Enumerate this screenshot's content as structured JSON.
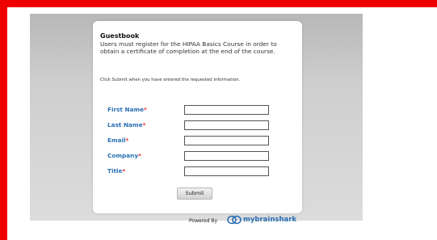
{
  "guestbook": {
    "title": "Guestbook",
    "description": "Users must register for the HIPAA Basics Course in order to obtain a certificate of completion at the end of the course.",
    "instructions": "Click Submit when you have entered the requested information."
  },
  "form": {
    "required_marker": "*",
    "fields": [
      {
        "label": "First Name",
        "value": ""
      },
      {
        "label": "Last Name",
        "value": ""
      },
      {
        "label": "Email",
        "value": ""
      },
      {
        "label": "Company",
        "value": ""
      },
      {
        "label": "Title",
        "value": ""
      }
    ],
    "submit_label": "Submit"
  },
  "footer": {
    "powered_by": "Powered By",
    "logo_my": "my",
    "logo_brand": "brainshark"
  },
  "colors": {
    "frame": "#ee0000",
    "label": "#2a6fb3",
    "required": "#e03030"
  },
  "icons": {
    "logo": "brainshark-logo-icon"
  }
}
